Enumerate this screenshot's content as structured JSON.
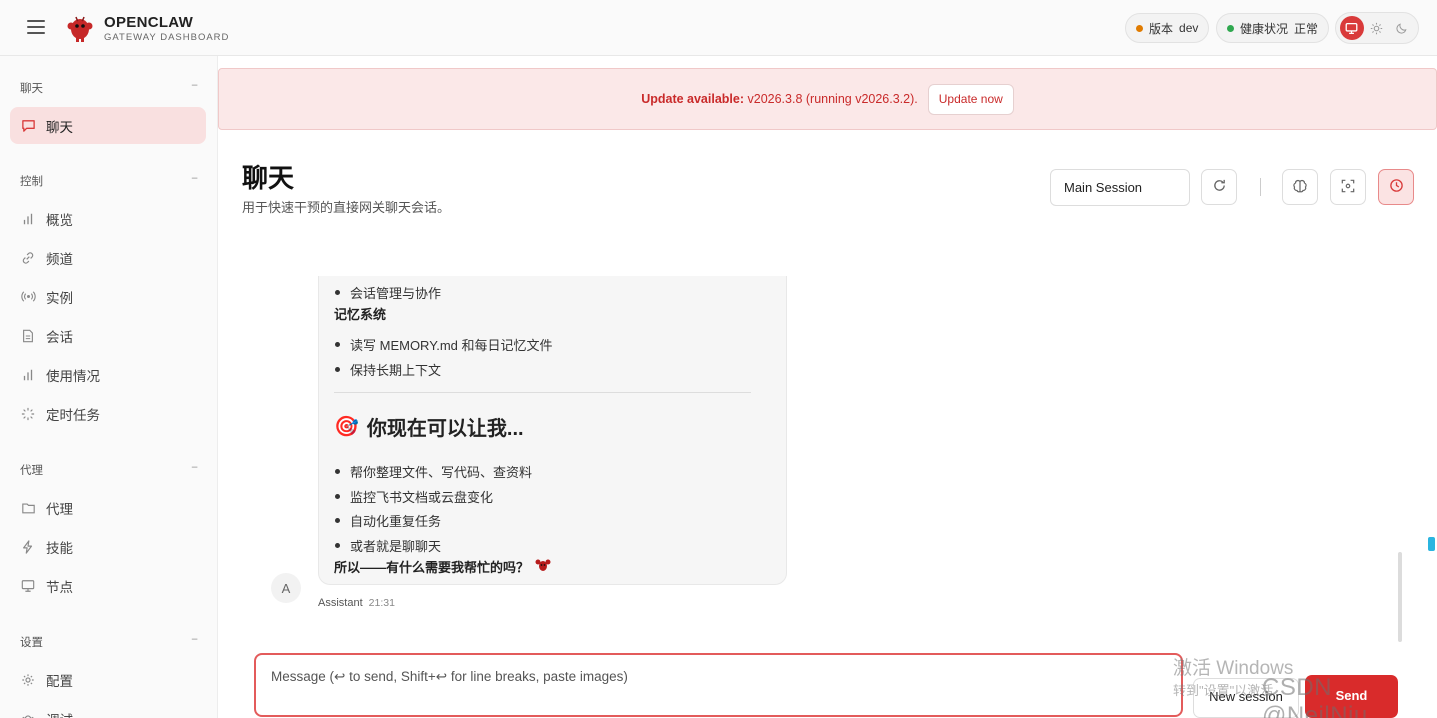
{
  "header": {
    "brand_title": "OPENCLAW",
    "brand_subtitle": "GATEWAY DASHBOARD",
    "version_label": "版本",
    "version_value": "dev",
    "health_label": "健康状况",
    "health_value": "正常",
    "colors": {
      "accent": "#d93a3a",
      "version_dot": "#e07b00",
      "health_dot": "#2fa84f"
    },
    "theme_icons": [
      "monitor-icon",
      "sun-icon",
      "moon-icon"
    ]
  },
  "sidebar": {
    "sections": [
      {
        "title": "聊天",
        "collapse": "−",
        "items": [
          {
            "label": "聊天",
            "icon": "message-icon",
            "active": true
          }
        ]
      },
      {
        "title": "控制",
        "collapse": "−",
        "items": [
          {
            "label": "概览",
            "icon": "bar-chart-icon"
          },
          {
            "label": "频道",
            "icon": "link-icon"
          },
          {
            "label": "实例",
            "icon": "radio-icon"
          },
          {
            "label": "会话",
            "icon": "file-icon"
          },
          {
            "label": "使用情况",
            "icon": "bar-chart-icon"
          },
          {
            "label": "定时任务",
            "icon": "loader-icon"
          }
        ]
      },
      {
        "title": "代理",
        "collapse": "−",
        "items": [
          {
            "label": "代理",
            "icon": "folder-icon"
          },
          {
            "label": "技能",
            "icon": "zap-icon"
          },
          {
            "label": "节点",
            "icon": "monitor-icon"
          }
        ]
      },
      {
        "title": "设置",
        "collapse": "−",
        "items": [
          {
            "label": "配置",
            "icon": "gear-icon"
          },
          {
            "label": "调试",
            "icon": "bug-icon"
          }
        ]
      }
    ]
  },
  "banner": {
    "prefix": "Update available:",
    "text": " v2026.3.8 (running v2026.3.2).",
    "button": "Update now"
  },
  "page": {
    "title": "聊天",
    "subtitle": "用于快速干预的直接网关聊天会话。",
    "session_select": "Main Session",
    "toolbar_icons": [
      "refresh-icon",
      "brain-icon",
      "focus-icon",
      "clock-icon"
    ]
  },
  "message": {
    "bullets_top": [
      "会话管理与协作"
    ],
    "section1_title": "记忆系统",
    "section1_items": [
      "读写 MEMORY.md 和每日记忆文件",
      "保持长期上下文"
    ],
    "heading_emoji": "🎯",
    "heading": "你现在可以让我...",
    "section2_items": [
      "帮你整理文件、写代码、查资料",
      "监控飞书文档或云盘变化",
      "自动化重复任务",
      "或者就是聊聊天"
    ],
    "closing": "所以——有什么需要我帮忙的吗？",
    "avatar": "A",
    "sender": "Assistant",
    "time": "21:31"
  },
  "compose": {
    "placeholder": "Message (↩ to send, Shift+↩ for line breaks, paste images)",
    "new_session": "New session",
    "send": "Send"
  },
  "watermarks": {
    "activate_title": "激活 Windows",
    "activate_sub": "转到\"设置\"以激活",
    "csdn": "CSDN @NeilNiu"
  }
}
